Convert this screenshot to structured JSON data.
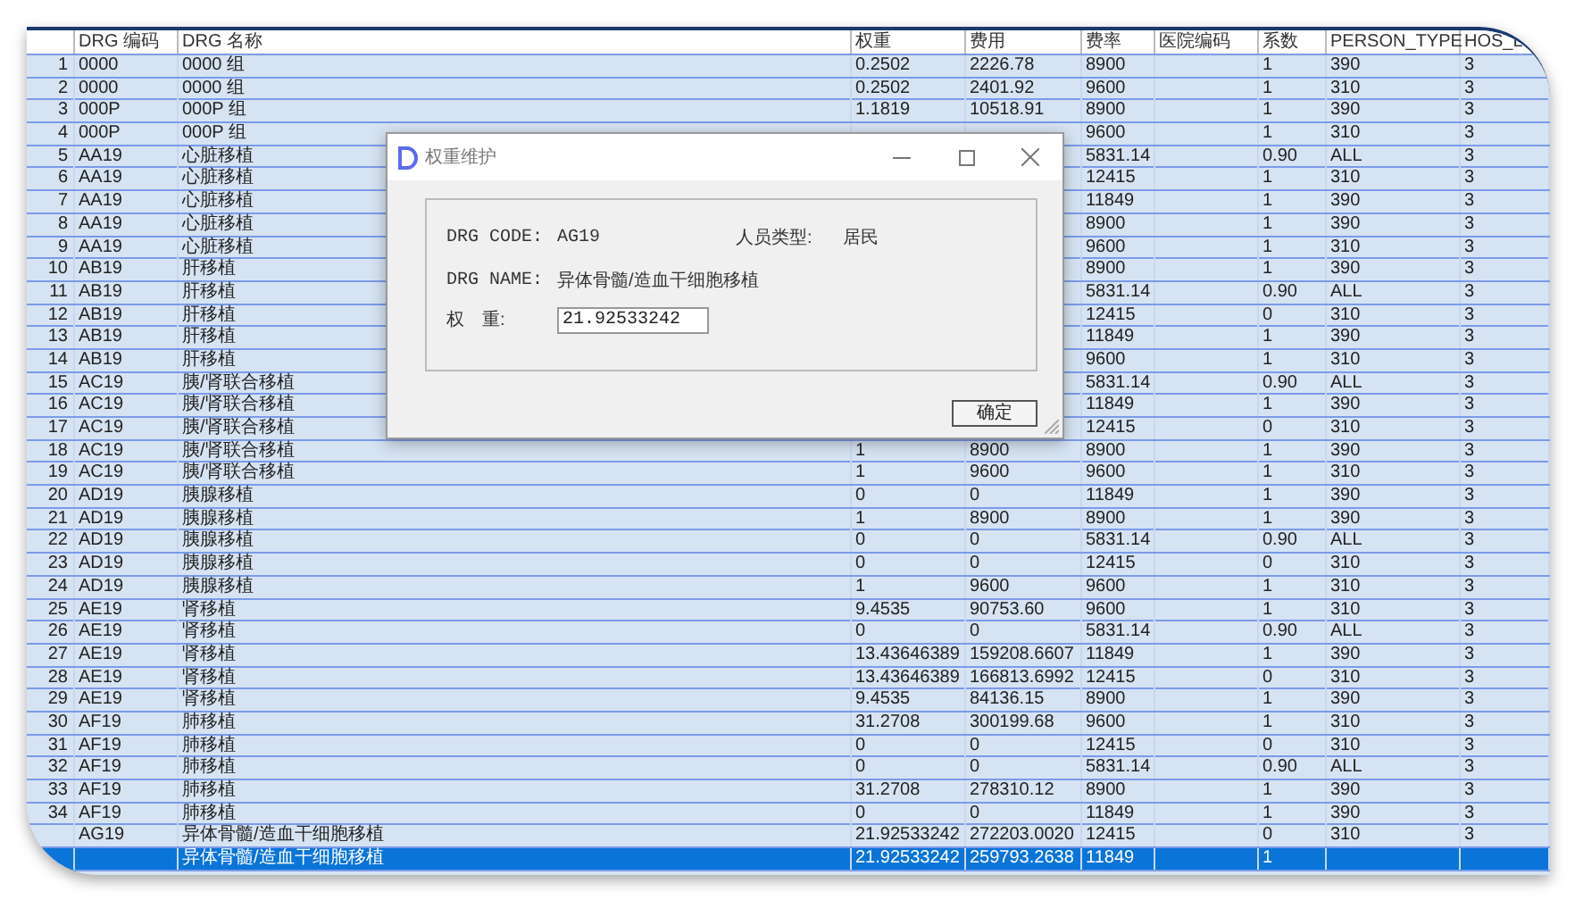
{
  "table": {
    "columns": [
      "DRG 编码",
      "DRG 名称",
      "权重",
      "费用",
      "费率",
      "医院编码",
      "系数",
      "PERSON_TYPE",
      "HOS_L"
    ],
    "rows": [
      {
        "num": "1",
        "code": "0000",
        "name": "0000 组",
        "weight": "0.2502",
        "fee": "2226.78",
        "rate": "8900",
        "coef": "1",
        "person_type": "390",
        "hos_level": "3",
        "selected": false
      },
      {
        "num": "2",
        "code": "0000",
        "name": "0000 组",
        "weight": "0.2502",
        "fee": "2401.92",
        "rate": "9600",
        "coef": "1",
        "person_type": "310",
        "hos_level": "3",
        "selected": false
      },
      {
        "num": "3",
        "code": "000P",
        "name": "000P 组",
        "weight": "1.1819",
        "fee": "10518.91",
        "rate": "8900",
        "coef": "1",
        "person_type": "390",
        "hos_level": "3",
        "selected": false
      },
      {
        "num": "4",
        "code": "000P",
        "name": "000P 组",
        "rate": "9600",
        "coef": "1",
        "person_type": "310",
        "hos_level": "3",
        "selected": false
      },
      {
        "num": "5",
        "code": "AA19",
        "name": "心脏移植",
        "rate": "5831.14",
        "coef": "0.90",
        "person_type": "ALL",
        "hos_level": "3",
        "selected": false
      },
      {
        "num": "6",
        "code": "AA19",
        "name": "心脏移植",
        "rate": "12415",
        "coef": "1",
        "person_type": "310",
        "hos_level": "3",
        "selected": false
      },
      {
        "num": "7",
        "code": "AA19",
        "name": "心脏移植",
        "rate": "11849",
        "coef": "1",
        "person_type": "390",
        "hos_level": "3",
        "selected": false
      },
      {
        "num": "8",
        "code": "AA19",
        "name": "心脏移植",
        "rate": "8900",
        "coef": "1",
        "person_type": "390",
        "hos_level": "3",
        "selected": false
      },
      {
        "num": "9",
        "code": "AA19",
        "name": "心脏移植",
        "rate": "9600",
        "coef": "1",
        "person_type": "310",
        "hos_level": "3",
        "selected": false
      },
      {
        "num": "10",
        "code": "AB19",
        "name": "肝移植",
        "rate": "8900",
        "coef": "1",
        "person_type": "390",
        "hos_level": "3",
        "selected": false
      },
      {
        "num": "11",
        "code": "AB19",
        "name": "肝移植",
        "rate": "5831.14",
        "coef": "0.90",
        "person_type": "ALL",
        "hos_level": "3",
        "selected": false
      },
      {
        "num": "12",
        "code": "AB19",
        "name": "肝移植",
        "rate": "12415",
        "coef": "0",
        "person_type": "310",
        "hos_level": "3",
        "selected": false
      },
      {
        "num": "13",
        "code": "AB19",
        "name": "肝移植",
        "rate": "11849",
        "coef": "1",
        "person_type": "390",
        "hos_level": "3",
        "selected": false
      },
      {
        "num": "14",
        "code": "AB19",
        "name": "肝移植",
        "rate": "9600",
        "coef": "1",
        "person_type": "310",
        "hos_level": "3",
        "selected": false
      },
      {
        "num": "15",
        "code": "AC19",
        "name": "胰/肾联合移植",
        "rate": "5831.14",
        "coef": "0.90",
        "person_type": "ALL",
        "hos_level": "3",
        "selected": false
      },
      {
        "num": "16",
        "code": "AC19",
        "name": "胰/肾联合移植",
        "rate": "11849",
        "coef": "1",
        "person_type": "390",
        "hos_level": "3",
        "selected": false
      },
      {
        "num": "17",
        "code": "AC19",
        "name": "胰/肾联合移植",
        "rate": "12415",
        "coef": "0",
        "person_type": "310",
        "hos_level": "3",
        "selected": false
      },
      {
        "num": "18",
        "code": "AC19",
        "name": "胰/肾联合移植",
        "weight": "1",
        "fee": "8900",
        "rate": "8900",
        "coef": "1",
        "person_type": "390",
        "hos_level": "3",
        "selected": false
      },
      {
        "num": "19",
        "code": "AC19",
        "name": "胰/肾联合移植",
        "weight": "1",
        "fee": "9600",
        "rate": "9600",
        "coef": "1",
        "person_type": "310",
        "hos_level": "3",
        "selected": false
      },
      {
        "num": "20",
        "code": "AD19",
        "name": "胰腺移植",
        "weight": "0",
        "fee": "0",
        "rate": "11849",
        "coef": "1",
        "person_type": "390",
        "hos_level": "3",
        "selected": false
      },
      {
        "num": "21",
        "code": "AD19",
        "name": "胰腺移植",
        "weight": "1",
        "fee": "8900",
        "rate": "8900",
        "coef": "1",
        "person_type": "390",
        "hos_level": "3",
        "selected": false
      },
      {
        "num": "22",
        "code": "AD19",
        "name": "胰腺移植",
        "weight": "0",
        "fee": "0",
        "rate": "5831.14",
        "coef": "0.90",
        "person_type": "ALL",
        "hos_level": "3",
        "selected": false
      },
      {
        "num": "23",
        "code": "AD19",
        "name": "胰腺移植",
        "weight": "0",
        "fee": "0",
        "rate": "12415",
        "coef": "0",
        "person_type": "310",
        "hos_level": "3",
        "selected": false
      },
      {
        "num": "24",
        "code": "AD19",
        "name": "胰腺移植",
        "weight": "1",
        "fee": "9600",
        "rate": "9600",
        "coef": "1",
        "person_type": "310",
        "hos_level": "3",
        "selected": false
      },
      {
        "num": "25",
        "code": "AE19",
        "name": "肾移植",
        "weight": "9.4535",
        "fee": "90753.60",
        "rate": "9600",
        "coef": "1",
        "person_type": "310",
        "hos_level": "3",
        "selected": false
      },
      {
        "num": "26",
        "code": "AE19",
        "name": "肾移植",
        "weight": "0",
        "fee": "0",
        "rate": "5831.14",
        "coef": "0.90",
        "person_type": "ALL",
        "hos_level": "3",
        "selected": false
      },
      {
        "num": "27",
        "code": "AE19",
        "name": "肾移植",
        "weight": "13.43646389",
        "fee": "159208.6607",
        "rate": "11849",
        "coef": "1",
        "person_type": "390",
        "hos_level": "3",
        "selected": false
      },
      {
        "num": "28",
        "code": "AE19",
        "name": "肾移植",
        "weight": "13.43646389",
        "fee": "166813.6992",
        "rate": "12415",
        "coef": "0",
        "person_type": "310",
        "hos_level": "3",
        "selected": false
      },
      {
        "num": "29",
        "code": "AE19",
        "name": "肾移植",
        "weight": "9.4535",
        "fee": "84136.15",
        "rate": "8900",
        "coef": "1",
        "person_type": "390",
        "hos_level": "3",
        "selected": false
      },
      {
        "num": "30",
        "code": "AF19",
        "name": "肺移植",
        "weight": "31.2708",
        "fee": "300199.68",
        "rate": "9600",
        "coef": "1",
        "person_type": "310",
        "hos_level": "3",
        "selected": false
      },
      {
        "num": "31",
        "code": "AF19",
        "name": "肺移植",
        "weight": "0",
        "fee": "0",
        "rate": "12415",
        "coef": "0",
        "person_type": "310",
        "hos_level": "3",
        "selected": false
      },
      {
        "num": "32",
        "code": "AF19",
        "name": "肺移植",
        "weight": "0",
        "fee": "0",
        "rate": "5831.14",
        "coef": "0.90",
        "person_type": "ALL",
        "hos_level": "3",
        "selected": false
      },
      {
        "num": "33",
        "code": "AF19",
        "name": "肺移植",
        "weight": "31.2708",
        "fee": "278310.12",
        "rate": "8900",
        "coef": "1",
        "person_type": "390",
        "hos_level": "3",
        "selected": false
      },
      {
        "num": "34",
        "code": "AF19",
        "name": "肺移植",
        "weight": "0",
        "fee": "0",
        "rate": "11849",
        "coef": "1",
        "person_type": "390",
        "hos_level": "3",
        "selected": false
      },
      {
        "code": "AG19",
        "name": "异体骨髓/造血干细胞移植",
        "weight": "21.92533242",
        "fee": "272203.0020",
        "rate": "12415",
        "coef": "0",
        "person_type": "310",
        "hos_level": "3",
        "selected": false
      },
      {
        "name": "异体骨髓/造血干细胞移植",
        "weight": "21.92533242",
        "fee": "259793.2638",
        "rate": "11849",
        "coef": "1",
        "selected": true
      }
    ]
  },
  "dialog": {
    "title": "权重维护",
    "code_label": "DRG CODE:",
    "code": "AG19",
    "person_label": "人员类型:",
    "person": "居民",
    "name_label": "DRG NAME:",
    "name": "异体骨髓/造血干细胞移植",
    "weight_label_1": "权",
    "weight_label_2": "重:",
    "weight": "21.92533242",
    "ok": "确定"
  }
}
